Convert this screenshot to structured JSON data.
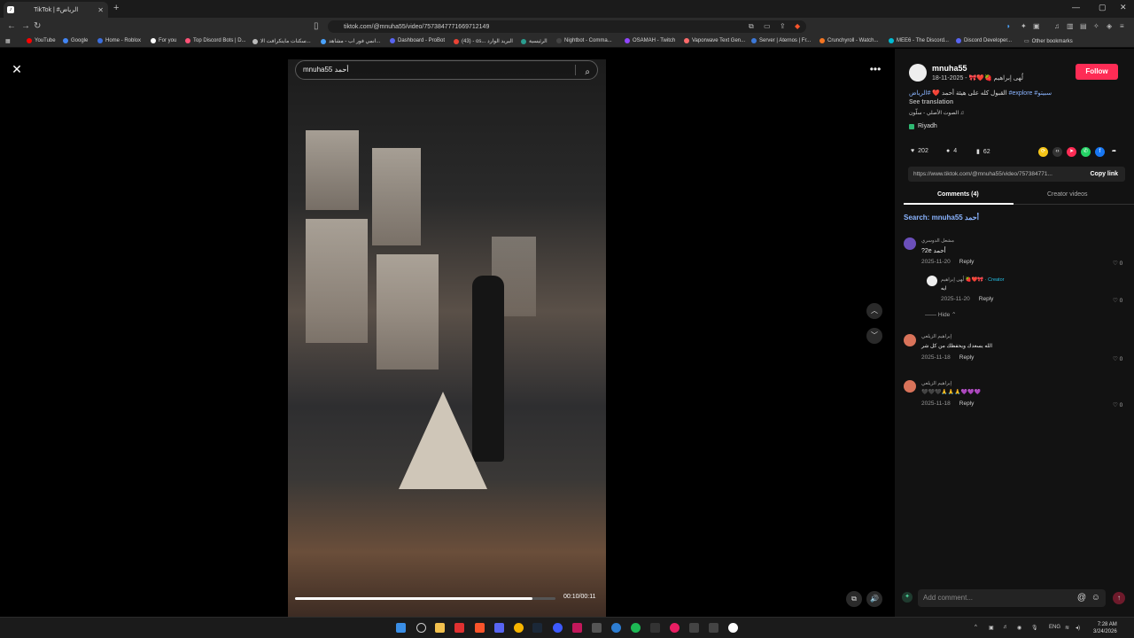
{
  "browser": {
    "tab_title": "TikTok | #الرياض",
    "tab_favicon": "♪",
    "new_tab_icon": "+",
    "url": "tiktok.com/@mnuha55/video/7573847771669712149",
    "window_controls": [
      "—",
      "▢",
      "✕"
    ],
    "bookmarks": [
      {
        "label": "YouTube",
        "color": "#ff0000"
      },
      {
        "label": "Google",
        "color": "#4285f4"
      },
      {
        "label": "Home - Roblox",
        "color": "#3b6fe0"
      },
      {
        "label": "For you",
        "color": "#ffffff"
      },
      {
        "label": "Top Discord Bots | D...",
        "color": "#ff5277"
      },
      {
        "label": "سكنات ماينكرافت الا...",
        "color": "#bbbbbb"
      },
      {
        "label": "انمي فور اب - مشاهد...",
        "color": "#4aa3ff"
      },
      {
        "label": "Dashboard - ProBot",
        "color": "#5865f2"
      },
      {
        "label": "(43) - os... البريد الوارد",
        "color": "#ea4335"
      },
      {
        "label": "الرئيسية",
        "color": "#2a9d8f"
      },
      {
        "label": "Nightbot - Comma...",
        "color": "#444444"
      },
      {
        "label": "OSAMAH - Twitch",
        "color": "#9146ff"
      },
      {
        "label": "Vaporwave Text Gen...",
        "color": "#ff6b6b"
      },
      {
        "label": "Server | Aternos | Fr...",
        "color": "#3c78d8"
      },
      {
        "label": "Crunchyroll - Watch...",
        "color": "#f47521"
      },
      {
        "label": "MEE6 - The Discord...",
        "color": "#00bcd4"
      },
      {
        "label": "Discord Developer...",
        "color": "#5865f2"
      }
    ],
    "other_bookmarks": "Other bookmarks"
  },
  "player": {
    "search_text": "mnuha55 أحمد",
    "current_time": "00:10/00:11",
    "progress": 0.91
  },
  "author": {
    "username": "mnuha55",
    "display_name": "لُهى إبراهيم 🍓❤️🎀",
    "date": "2025-11-18",
    "follow_label": "Follow"
  },
  "post": {
    "caption": "القبول كله على هيئة أحمد ❤️",
    "hashtags": "#الرياض #explore #سبيتو",
    "see_translation": "See translation",
    "sound": "الصوت الأصلي - سلّون ♫",
    "location": "Riyadh",
    "likes": "202",
    "comments": "4",
    "saves": "62",
    "link": "https://www.tiktok.com/@mnuha55/video/757384771...",
    "copy_link": "Copy link"
  },
  "tabs": {
    "comments": "Comments (4)",
    "creator_videos": "Creator videos"
  },
  "search": {
    "prefix": "Search:",
    "query": "mnuha55 أحمد"
  },
  "comments": [
    {
      "name": "مشعل الدوسري",
      "text": "?2e أحمد",
      "date": "2025-11-20",
      "reply": "Reply",
      "likes": "0",
      "color": "#6b4fbb"
    },
    {
      "name": "لُهى إبراهيم 🍓❤️🎀",
      "creator": "· Creator",
      "text": "ايه",
      "date": "2025-11-20",
      "reply": "Reply",
      "likes": "0",
      "color": "#eeeeee"
    },
    {
      "name": "إبراهيم الزيلعي",
      "text": "الله يسعدك ويحفظك من كل شر",
      "date": "2025-11-18",
      "reply": "Reply",
      "likes": "0",
      "color": "#d9735a"
    },
    {
      "name": "إبراهيم الزيلعي",
      "text": "🖤🖤🖤🙏🙏🙏💜💜💜",
      "date": "2025-11-18",
      "reply": "Reply",
      "likes": "0",
      "color": "#d9735a"
    }
  ],
  "hide_label": "Hide ⌃",
  "add_comment_placeholder": "Add comment...",
  "taskbar": {
    "lang": "ENG",
    "time": "7:28 AM",
    "date": "3/24/2026"
  }
}
